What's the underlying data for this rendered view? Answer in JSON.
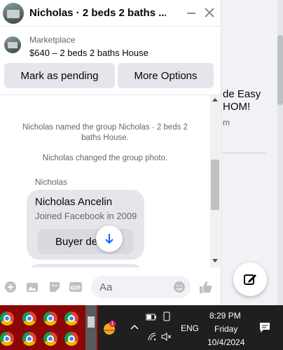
{
  "chat": {
    "title": "Nicholas · 2 beds 2 baths ...",
    "listing": {
      "source": "Marketplace",
      "title": "$640 – 2 beds 2 baths House",
      "buttons": [
        "Mark as pending",
        "More Options"
      ]
    },
    "messages": {
      "system": [
        "Nicholas named the group Nicholas · 2 beds 2 baths House.",
        "Nicholas changed the group photo."
      ],
      "sender": "Nicholas",
      "card": {
        "name": "Nicholas Ancelin",
        "subtitle": "Joined Facebook in 2009",
        "button": "Buyer de"
      }
    },
    "composer": {
      "placeholder": "Aa"
    }
  },
  "background": {
    "listing_text_line1": "de Easy",
    "listing_text_line2": "HOM!",
    "listing_sub": "m"
  },
  "taskbar": {
    "language": "ENG",
    "time": "8:29 PM",
    "day": "Friday",
    "date": "10/4/2024",
    "notification_badge": "1"
  },
  "icons": {
    "header": [
      "minimize-icon",
      "close-icon"
    ],
    "composer": [
      "plus-icon",
      "photo-icon",
      "sticker-icon",
      "gif-icon",
      "emoji-icon",
      "like-icon"
    ],
    "fab": "compose-icon",
    "scroll": "arrow-down-icon"
  },
  "colors": {
    "accent": "#0866ff",
    "bubble": "#e4e6eb",
    "taskbar": "#1f1f1f",
    "taskbar_apps": "#8c0606"
  }
}
